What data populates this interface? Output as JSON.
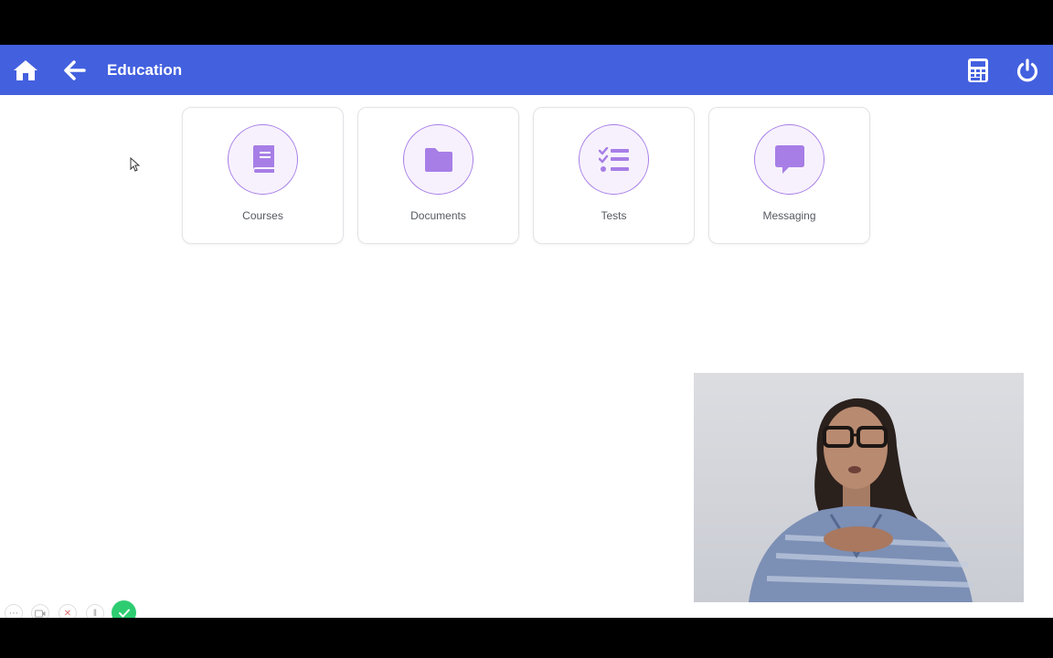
{
  "header": {
    "title": "Education",
    "home_icon": "home-icon",
    "back_icon": "arrow-left-icon",
    "calculator_icon": "calculator-icon",
    "power_icon": "power-icon",
    "background": "#4360df"
  },
  "tiles": [
    {
      "label": "Courses",
      "icon": "book-icon"
    },
    {
      "label": "Documents",
      "icon": "folder-icon"
    },
    {
      "label": "Tests",
      "icon": "checklist-icon"
    },
    {
      "label": "Messaging",
      "icon": "chat-bubble-icon"
    }
  ],
  "accent_color": "#a77ee6",
  "recording_toolbar": {
    "more_label": "⋯",
    "cancel_label": "✕",
    "pause_label": "‖"
  }
}
